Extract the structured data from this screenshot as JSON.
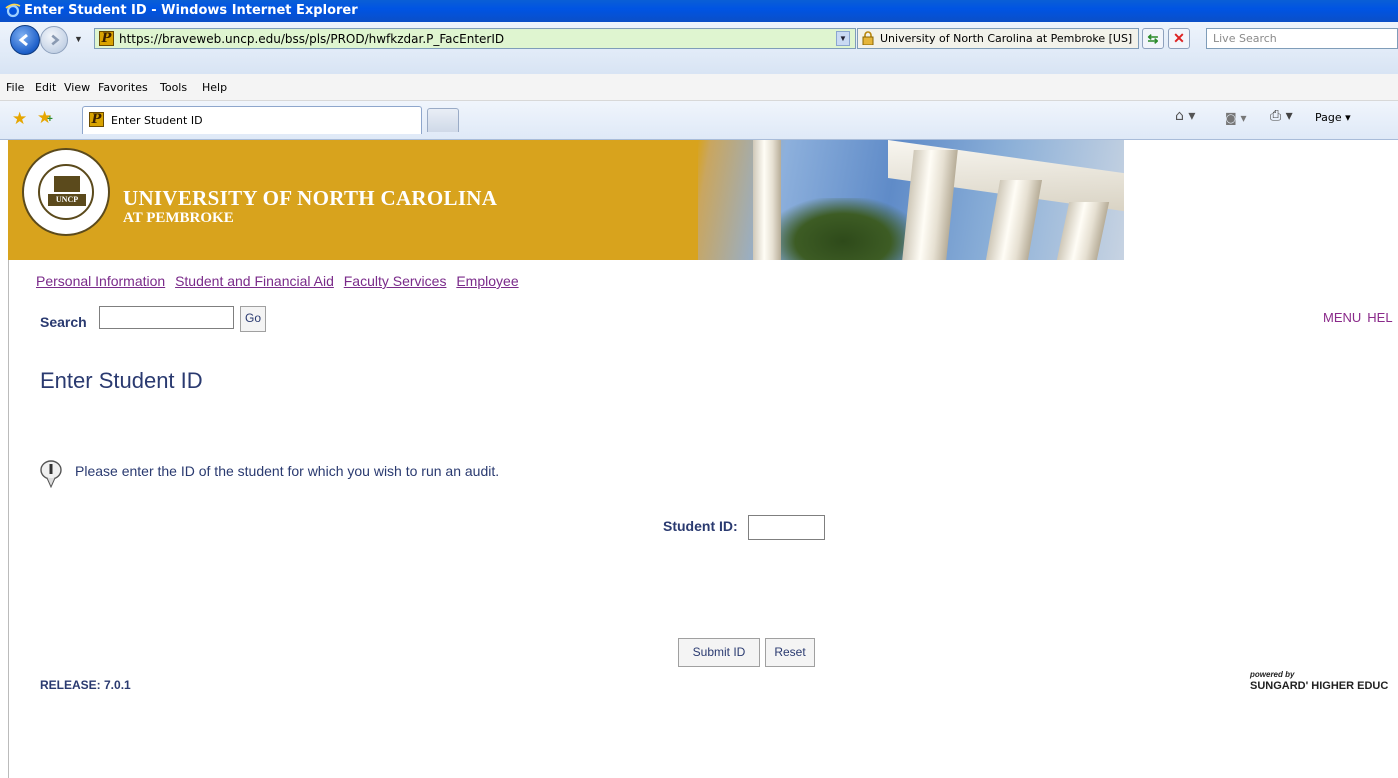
{
  "window": {
    "title": "Enter Student ID - Windows Internet Explorer"
  },
  "address_bar": {
    "url": "https://braveweb.uncp.edu/bss/pls/PROD/hwfkzdar.P_FacEnterID",
    "certificate": "University of North Carolina at Pembroke [US]",
    "search_placeholder": "Live Search"
  },
  "menu": [
    "File",
    "Edit",
    "View",
    "Favorites",
    "Tools",
    "Help"
  ],
  "tab": {
    "label": "Enter Student ID"
  },
  "command_bar": {
    "page_label": "Page ▾"
  },
  "banner": {
    "name": "UNIVERSITY OF NORTH CAROLINA",
    "subname": "AT PEMBROKE",
    "seal_text": "UNCP"
  },
  "nav_links": [
    "Personal Information",
    "Student and Financial Aid",
    "Faculty Services",
    "Employee"
  ],
  "search": {
    "label": "Search",
    "button": "Go"
  },
  "right_menu": [
    "MENU",
    "HEL"
  ],
  "page": {
    "title": "Enter Student ID",
    "info": "Please enter the ID of the student for which you wish to run an audit.",
    "student_id_label": "Student ID:",
    "submit_label": "Submit ID",
    "reset_label": "Reset"
  },
  "footer": {
    "release": "RELEASE: 7.0.1",
    "powered_by": "powered by",
    "vendor": "SUNGARD' HIGHER EDUC"
  },
  "colors": {
    "banner": "#d8a31d",
    "link": "#7a2a8a",
    "text": "#2a3a70",
    "titlebar": "#0054e3"
  }
}
